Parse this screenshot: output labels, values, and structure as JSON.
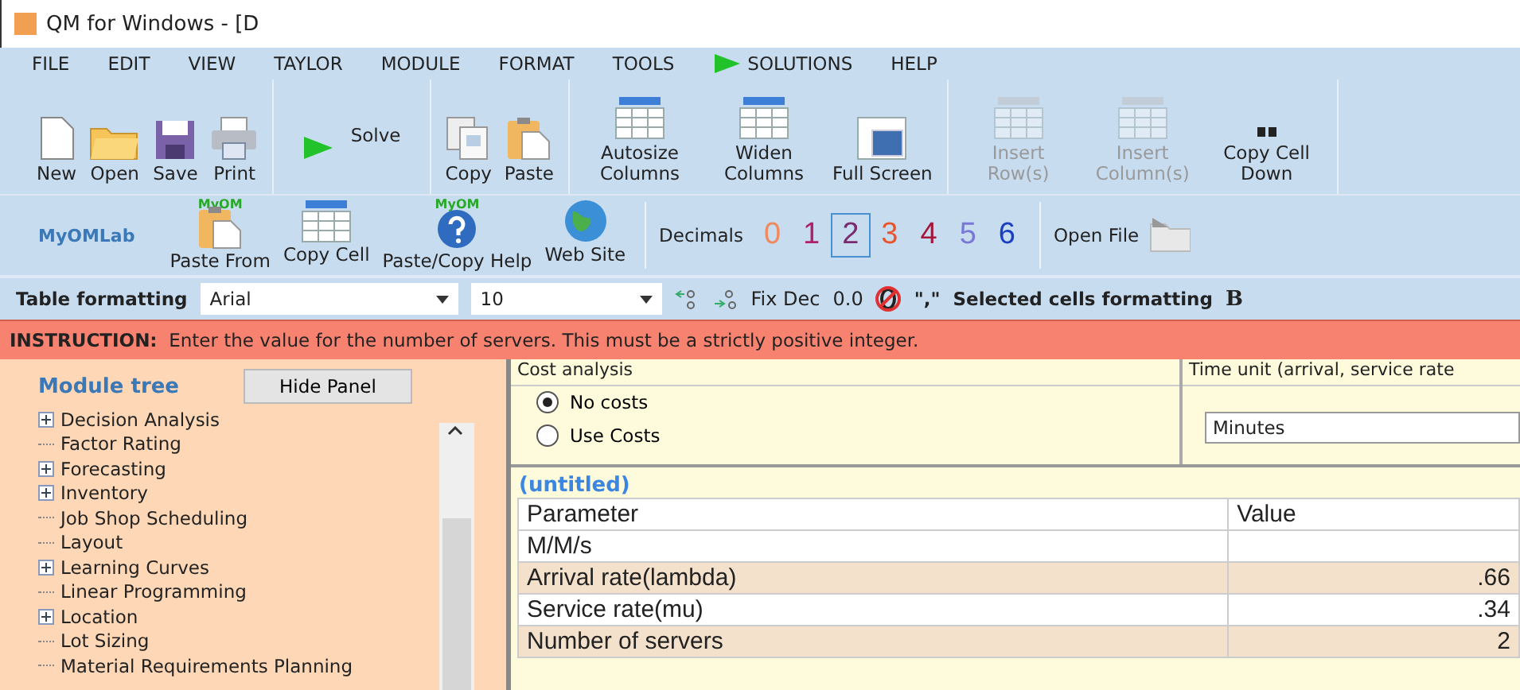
{
  "window": {
    "title": "QM for Windows - [D"
  },
  "menu": [
    {
      "label": "FILE",
      "kind": "plain"
    },
    {
      "label": "EDIT",
      "kind": "plain"
    },
    {
      "label": "VIEW",
      "kind": "plain"
    },
    {
      "label": "TAYLOR",
      "kind": "plain"
    },
    {
      "label": "MODULE",
      "kind": "plain"
    },
    {
      "label": "FORMAT",
      "kind": "plain"
    },
    {
      "label": "TOOLS",
      "kind": "plain"
    },
    {
      "label": "SOLUTIONS",
      "kind": "play"
    },
    {
      "label": "HELP",
      "kind": "plain"
    }
  ],
  "toolbar": [
    {
      "tools": [
        {
          "label": "New",
          "kind": "file",
          "disabled": false
        },
        {
          "label": "Open",
          "kind": "folder",
          "disabled": false
        },
        {
          "label": "Save",
          "kind": "disk",
          "disabled": false
        },
        {
          "label": "Print",
          "kind": "printer",
          "disabled": false
        }
      ]
    },
    {
      "tools": [
        {
          "label": "Solve",
          "kind": "solve",
          "disabled": false
        }
      ]
    },
    {
      "tools": [
        {
          "label": "Copy",
          "kind": "copy",
          "disabled": false
        },
        {
          "label": "Paste",
          "kind": "paste",
          "disabled": false
        }
      ]
    },
    {
      "tools": [
        {
          "label": "Autosize Columns",
          "kind": "grid",
          "disabled": false
        },
        {
          "label": "Widen Columns",
          "kind": "grid",
          "disabled": false
        },
        {
          "label": "Full Screen",
          "kind": "screen",
          "disabled": false
        }
      ]
    },
    {
      "tools": [
        {
          "label": "Insert Row(s)",
          "kind": "grid",
          "disabled": true
        },
        {
          "label": "Insert Column(s)",
          "kind": "grid",
          "disabled": true
        },
        {
          "label": "Copy Cell Down",
          "kind": "quote",
          "disabled": false
        }
      ]
    }
  ],
  "toolbar2": {
    "brand": "MyOMLab",
    "tools": [
      {
        "label": "Paste From",
        "kind": "paste",
        "badge": "MyOM"
      },
      {
        "label": "Copy Cell",
        "kind": "grid"
      },
      {
        "label": "Paste/Copy Help",
        "kind": "help",
        "badge": "MyOM"
      },
      {
        "label": "Web Site",
        "kind": "globe"
      }
    ],
    "decimals": {
      "label": "Decimals",
      "digits": [
        {
          "label": "0",
          "color": "#f08a5d",
          "selected": false
        },
        {
          "label": "1",
          "color": "#b0206a",
          "selected": false
        },
        {
          "label": "2",
          "color": "#7a2a6e",
          "selected": true
        },
        {
          "label": "3",
          "color": "#e8542c",
          "selected": false
        },
        {
          "label": "4",
          "color": "#a5173a",
          "selected": false
        },
        {
          "label": "5",
          "color": "#7a78d6",
          "selected": false
        },
        {
          "label": "6",
          "color": "#1a3fc0",
          "selected": false
        }
      ]
    },
    "open_file": "Open File"
  },
  "format_bar": {
    "label": "Table formatting",
    "font": "Arial",
    "size": "10",
    "fix_dec": "Fix Dec",
    "zero_format": "0.0",
    "comma": "\",\"",
    "selected_label": "Selected cells formatting",
    "bold": "B"
  },
  "instruction": {
    "text": "**INSTRUCTION:**  Enter the value for the number of servers. This must be a strictly positive integer."
  },
  "sidebar": {
    "title": "Module tree",
    "hide_button": "Hide Panel",
    "items": [
      {
        "label": "Decision Analysis",
        "kind": "group"
      },
      {
        "label": "Factor Rating",
        "kind": "leaf"
      },
      {
        "label": "Forecasting",
        "kind": "group"
      },
      {
        "label": "Inventory",
        "kind": "group"
      },
      {
        "label": "Job Shop Scheduling",
        "kind": "leaf"
      },
      {
        "label": "Layout",
        "kind": "leaf"
      },
      {
        "label": "Learning Curves",
        "kind": "group"
      },
      {
        "label": "Linear Programming",
        "kind": "leaf"
      },
      {
        "label": "Location",
        "kind": "group"
      },
      {
        "label": "Lot Sizing",
        "kind": "leaf"
      },
      {
        "label": "Material Requirements Planning",
        "kind": "leaf"
      }
    ]
  },
  "cost_analysis": {
    "title": "Cost analysis",
    "options": [
      {
        "label": "No costs",
        "selected": true
      },
      {
        "label": "Use Costs",
        "selected": false
      }
    ]
  },
  "time_unit": {
    "title": "Time unit (arrival, service rate",
    "value": "Minutes"
  },
  "table": {
    "title": "(untitled)",
    "columns": [
      "Parameter",
      "Value"
    ],
    "rows": [
      [
        "M/M/s",
        ""
      ],
      [
        "Arrival rate(lambda)",
        ".66"
      ],
      [
        "Service rate(mu)",
        ".34"
      ],
      [
        "Number of servers",
        "2"
      ]
    ]
  }
}
